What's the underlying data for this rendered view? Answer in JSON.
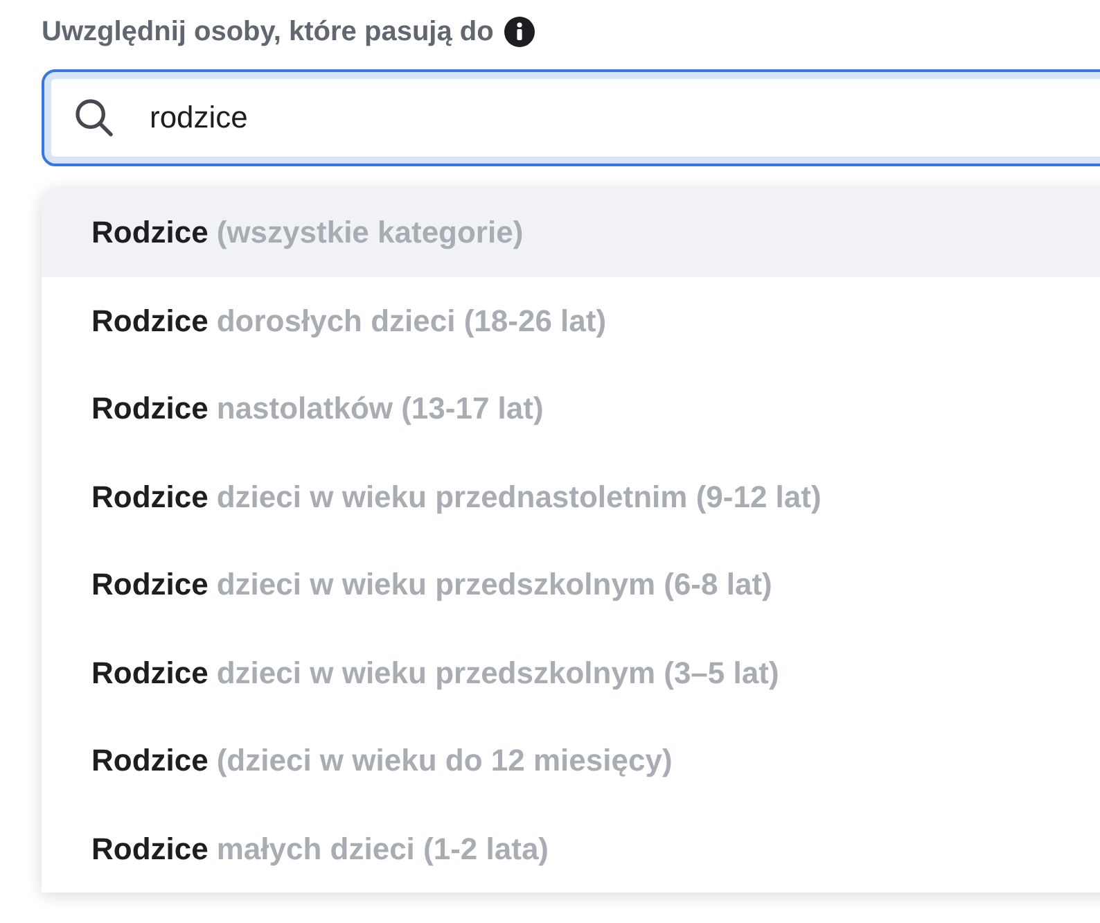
{
  "section": {
    "label": "Uwzględnij osoby, które pasują do"
  },
  "search": {
    "value": "rodzice"
  },
  "suggestions": [
    {
      "term": "Rodzice",
      "detail": "(wszystkie kategorie)",
      "selected": true
    },
    {
      "term": "Rodzice",
      "detail": "dorosłych dzieci (18-26 lat)",
      "selected": false
    },
    {
      "term": "Rodzice",
      "detail": "nastolatków (13-17 lat)",
      "selected": false
    },
    {
      "term": "Rodzice",
      "detail": "dzieci w wieku przednastoletnim (9-12 lat)",
      "selected": false
    },
    {
      "term": "Rodzice",
      "detail": "dzieci w wieku przedszkolnym (6-8 lat)",
      "selected": false
    },
    {
      "term": "Rodzice",
      "detail": "dzieci w wieku przedszkolnym (3–5 lat)",
      "selected": false
    },
    {
      "term": "Rodzice",
      "detail": "(dzieci w wieku do 12 miesięcy)",
      "selected": false
    },
    {
      "term": "Rodzice",
      "detail": "małych dzieci (1-2 lata)",
      "selected": false
    }
  ]
}
